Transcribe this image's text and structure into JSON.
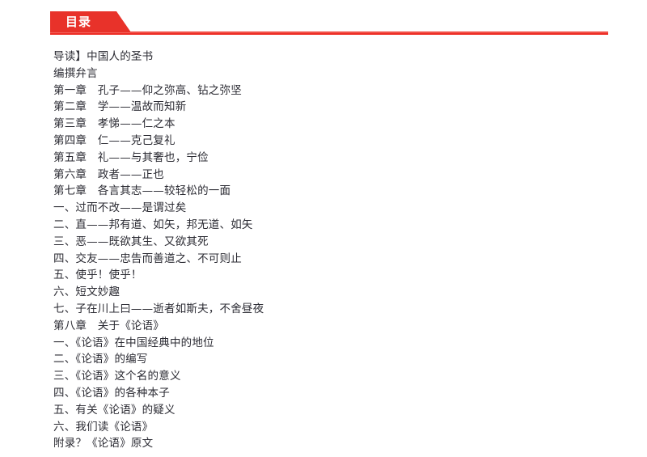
{
  "header": {
    "tab_label": "目录",
    "accent_color": "#e8322a",
    "rule_color": "#ed2d24"
  },
  "contents": {
    "entries": [
      {
        "text": "导读】中国人的圣书"
      },
      {
        "text": "编撰弁言"
      },
      {
        "text": "第一章　孔子——仰之弥高、钻之弥坚"
      },
      {
        "text": "第二章　学——温故而知新"
      },
      {
        "text": "第三章　孝悌——仁之本"
      },
      {
        "text": "第四章　仁——克己复礼"
      },
      {
        "text": "第五章　礼——与其奢也，宁俭"
      },
      {
        "text": "第六章　政者——正也"
      },
      {
        "text": "第七章　各言其志——较轻松的一面"
      },
      {
        "text": "一、过而不改——是谓过矣"
      },
      {
        "text": "二、直——邦有道、如矢，邦无道、如矢"
      },
      {
        "text": "三、恶——既欲其生、又欲其死"
      },
      {
        "text": "四、交友——忠告而善道之、不可则止"
      },
      {
        "text": "五、使乎！使乎！"
      },
      {
        "text": "六、短文妙趣"
      },
      {
        "text": "七、子在川上曰——逝者如斯夫，不舍昼夜"
      },
      {
        "text": "第八章　关于《论语》"
      },
      {
        "text": "一、《论语》在中国经典中的地位"
      },
      {
        "text": "二、《论语》的编写"
      },
      {
        "text": "三、《论语》这个名的意义"
      },
      {
        "text": "四、《论语》的各种本子"
      },
      {
        "text": "五、有关《论语》的疑义"
      },
      {
        "text": "六、我们读《论语》"
      },
      {
        "text": "附录？《论语》原文"
      }
    ]
  }
}
